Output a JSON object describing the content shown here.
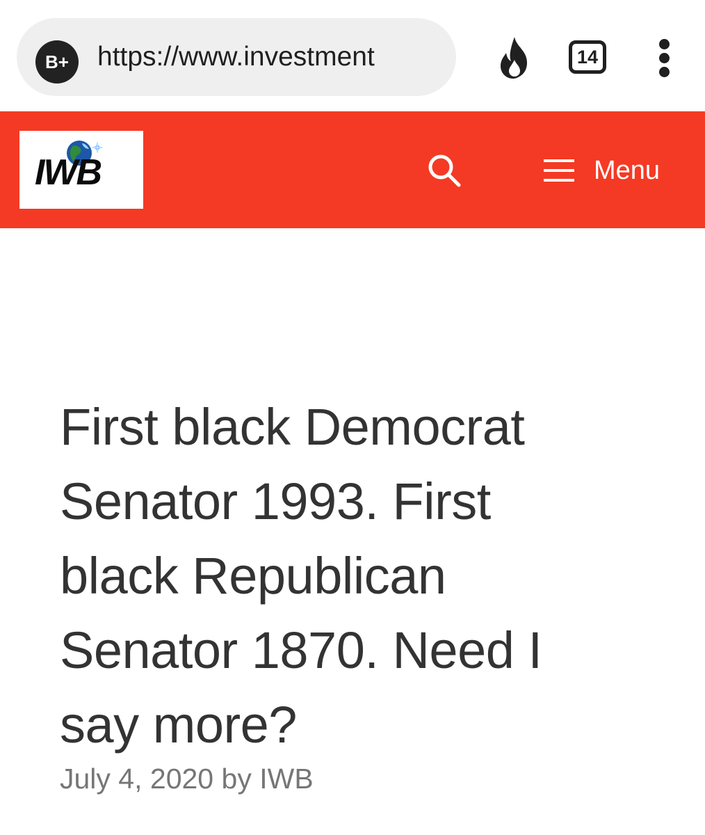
{
  "browser": {
    "site_badge": "B+",
    "url": "https://www.investment",
    "tab_count": "14",
    "icons": [
      "flame-icon",
      "overflow-menu-icon"
    ]
  },
  "site_header": {
    "logo_text": "IWB",
    "search_icon": "search-icon",
    "menu_icon": "hamburger-icon",
    "menu_label": "Menu",
    "accent_color": "#f43a24"
  },
  "article": {
    "title_lines": [
      "First black Democrat",
      "Senator 1993. First",
      "black Republican",
      "Senator 1870. Need I",
      "say more?"
    ],
    "date": "July 4, 2020",
    "by_label": "by",
    "author": "IWB"
  }
}
